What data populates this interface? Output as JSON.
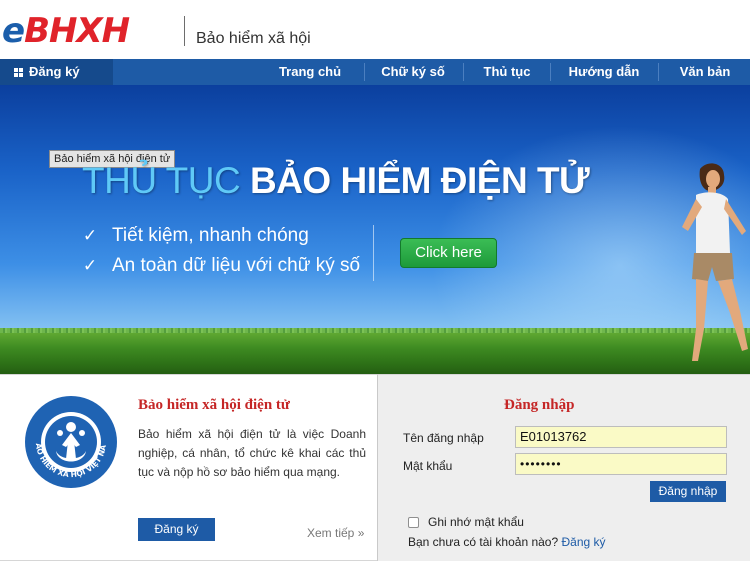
{
  "header": {
    "logo_e": "e",
    "logo_rest": "BHXH",
    "subtitle": "Bảo hiểm xã hội"
  },
  "nav": {
    "register_label": "Đăng ký",
    "items": [
      {
        "label": "Trang chủ"
      },
      {
        "label": "Chữ ký số"
      },
      {
        "label": "Thủ tục"
      },
      {
        "label": "Hướng dẫn"
      },
      {
        "label": "Văn bản"
      }
    ]
  },
  "banner": {
    "tooltip": "Bảo hiểm xã hội điện tử",
    "title_part1": "THỦ TỤC ",
    "title_part2": "BẢO HIỂM ĐIỆN TỬ",
    "features": [
      "Tiết kiệm, nhanh chóng",
      "An toàn dữ liệu với chữ ký số"
    ],
    "button": "Click here"
  },
  "intro": {
    "title": "Bảo hiểm xã hội điện tử",
    "description": "Bảo hiểm xã hội điện tử là việc Doanh nghiệp, cá nhân, tổ chức kê khai các thủ tục và nộp hồ sơ bảo hiểm qua mạng.",
    "register_button": "Đăng ký",
    "more_link": "Xem tiếp »",
    "emblem_text": "BẢO HIỂM XÃ HỘI VIỆT NAM"
  },
  "login": {
    "title": "Đăng nhập",
    "username_label": "Tên đăng nhập",
    "username_value": "E01013762",
    "password_label": "Mật khẩu",
    "password_value": "••••••••",
    "login_button": "Đăng nhập",
    "remember_label": "Ghi nhớ mật khẩu",
    "no_account_text": "Bạn chưa có tài khoản nào?",
    "register_link": "Đăng ký"
  },
  "colors": {
    "brand_blue": "#1e5ba6",
    "brand_red": "#e0232a",
    "title_red": "#c52626",
    "input_bg": "#fafac6"
  }
}
